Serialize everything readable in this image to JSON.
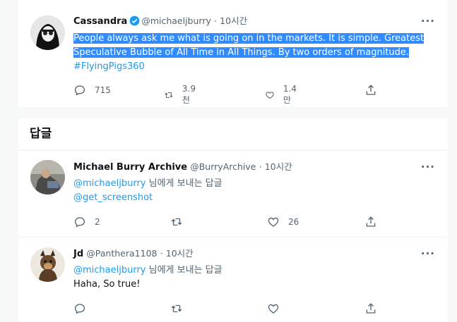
{
  "main_tweet": {
    "name": "Cassandra",
    "handle": "@michaeljburry",
    "dot": "·",
    "time": "10시간",
    "more": "···",
    "text_line1": "People always ask me what is going on in the markets. It is simple. Greatest",
    "text_line2": "Speculative Bubble of All Time in All Things. By two orders of magnitude.",
    "hashtag": "#FlyingPigs360",
    "replies": "715",
    "retweets": "3.9천",
    "likes": "1.4만"
  },
  "replies_section": {
    "title": "답글"
  },
  "replies": [
    {
      "name": "Michael Burry Archive",
      "handle": "@BurryArchive",
      "dot": "·",
      "time": "10시간",
      "more": "···",
      "reply_to_mention": "@michaeljburry",
      "reply_to_suffix": " 님에게 보내는 답글",
      "text": "@get_screenshot",
      "replies": "2",
      "retweets": "",
      "likes": "26"
    },
    {
      "name": "Jd",
      "handle": "@Panthera1108",
      "dot": "·",
      "time": "10시간",
      "more": "···",
      "reply_to_mention": "@michaeljburry",
      "reply_to_suffix": " 님에게 보내는 답글",
      "text": "Haha, So true!",
      "replies": "",
      "retweets": "",
      "likes": ""
    }
  ],
  "colors": {
    "accent": "#1d9bf0",
    "highlight": "#2f8bff",
    "muted": "#536471"
  },
  "icons": [
    "reply-icon",
    "retweet-icon",
    "like-icon",
    "share-icon",
    "verified-badge-icon",
    "more-icon"
  ]
}
